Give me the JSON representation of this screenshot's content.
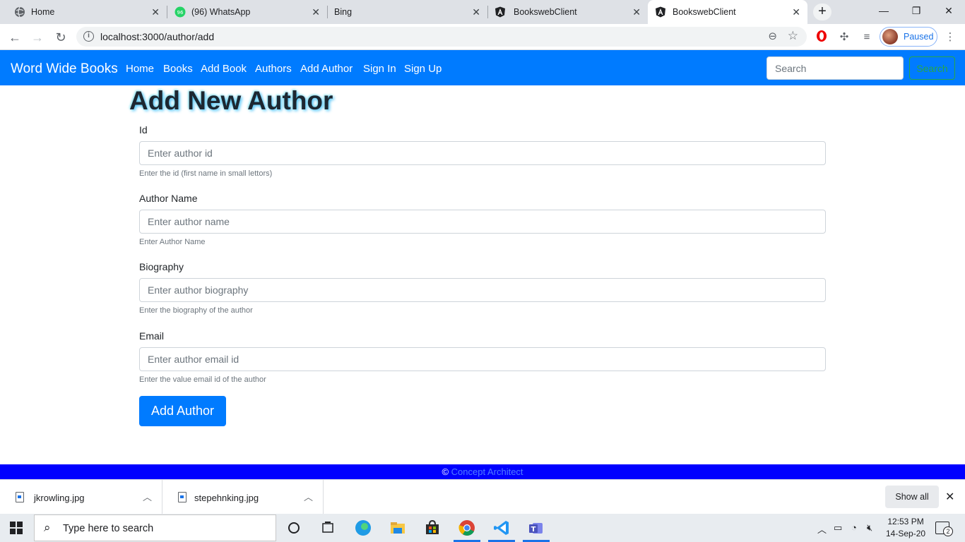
{
  "browser": {
    "tabs": [
      {
        "title": "Home",
        "icon": "globe-icon"
      },
      {
        "title": "(96) WhatsApp",
        "icon": "whatsapp-icon",
        "badge": "96"
      },
      {
        "title": "Bing",
        "icon": "bing-icon"
      },
      {
        "title": "BookswebClient",
        "icon": "angular-icon"
      },
      {
        "title": "BookswebClient",
        "icon": "angular-icon",
        "active": true
      }
    ],
    "url": "localhost:3000/author/add",
    "profile_status": "Paused"
  },
  "navbar": {
    "brand": "Word Wide Books",
    "links": [
      "Home",
      "Books",
      "Add Book",
      "Authors",
      "Add Author",
      "Sign In",
      "Sign Up"
    ],
    "search_placeholder": "Search",
    "search_button": "Search"
  },
  "form": {
    "title": "Add New Author",
    "fields": [
      {
        "label": "Id",
        "placeholder": "Enter author id",
        "help": "Enter the id (first name in small lettors)"
      },
      {
        "label": "Author Name",
        "placeholder": "Enter author name",
        "help": "Enter Author Name"
      },
      {
        "label": "Biography",
        "placeholder": "Enter author biography",
        "help": "Enter the biography of the author"
      },
      {
        "label": "Email",
        "placeholder": "Enter author email id",
        "help": "Enter the value email id of the author"
      }
    ],
    "submit_label": "Add Author"
  },
  "footer": {
    "symbol": "©",
    "link_text": "Concept Architect"
  },
  "downloads": {
    "files": [
      "jkrowling.jpg",
      "stepehnking.jpg"
    ],
    "show_all": "Show all"
  },
  "taskbar": {
    "search_text": "Type here to search",
    "time": "12:53 PM",
    "date": "14-Sep-20",
    "notification_count": "2"
  },
  "colors": {
    "navbar": "#007bff",
    "footer": "#0000ff",
    "success": "#28a745"
  }
}
